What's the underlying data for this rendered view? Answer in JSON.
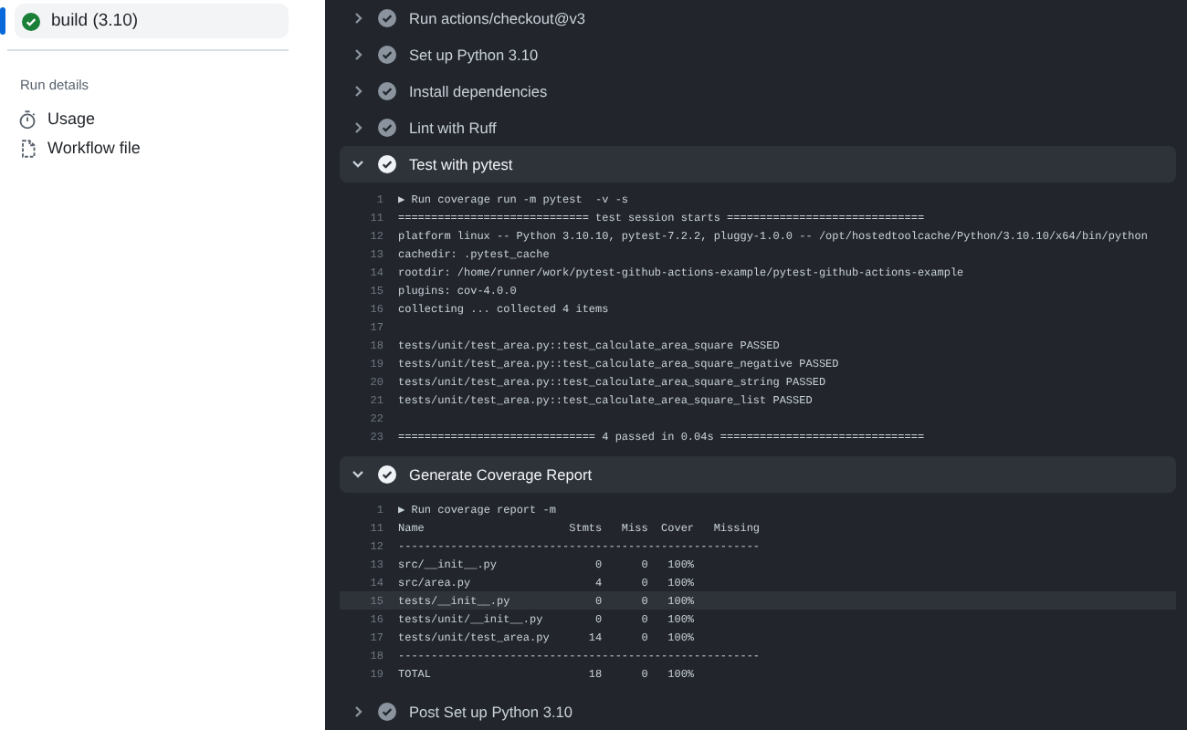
{
  "sidebar": {
    "jobs": [
      {
        "label": "build (3.10)",
        "selected": true
      }
    ],
    "section_title": "Run details",
    "items": [
      {
        "label": "Usage",
        "kind": "usage"
      },
      {
        "label": "Workflow file",
        "kind": "workflow"
      }
    ]
  },
  "steps": [
    {
      "name": "Run actions/checkout@v3",
      "expanded": false
    },
    {
      "name": "Set up Python 3.10",
      "expanded": false
    },
    {
      "name": "Install dependencies",
      "expanded": false
    },
    {
      "name": "Lint with Ruff",
      "expanded": false
    },
    {
      "name": "Test with pytest",
      "expanded": true,
      "log": [
        {
          "number": "1",
          "text": "▶ Run coverage run -m pytest  -v -s",
          "highlighted": false
        },
        {
          "number": "11",
          "text": "============================= test session starts ==============================",
          "highlighted": false
        },
        {
          "number": "12",
          "text": "platform linux -- Python 3.10.10, pytest-7.2.2, pluggy-1.0.0 -- /opt/hostedtoolcache/Python/3.10.10/x64/bin/python",
          "highlighted": false
        },
        {
          "number": "13",
          "text": "cachedir: .pytest_cache",
          "highlighted": false
        },
        {
          "number": "14",
          "text": "rootdir: /home/runner/work/pytest-github-actions-example/pytest-github-actions-example",
          "highlighted": false
        },
        {
          "number": "15",
          "text": "plugins: cov-4.0.0",
          "highlighted": false
        },
        {
          "number": "16",
          "text": "collecting ... collected 4 items",
          "highlighted": false
        },
        {
          "number": "17",
          "highlighted": false
        },
        {
          "number": "18",
          "text": "tests/unit/test_area.py::test_calculate_area_square PASSED",
          "highlighted": false
        },
        {
          "number": "19",
          "text": "tests/unit/test_area.py::test_calculate_area_square_negative PASSED",
          "highlighted": false
        },
        {
          "number": "20",
          "text": "tests/unit/test_area.py::test_calculate_area_square_string PASSED",
          "highlighted": false
        },
        {
          "number": "21",
          "text": "tests/unit/test_area.py::test_calculate_area_square_list PASSED",
          "highlighted": false
        },
        {
          "number": "22",
          "highlighted": false
        },
        {
          "number": "23",
          "text": "============================== 4 passed in 0.04s ===============================",
          "highlighted": false
        }
      ]
    },
    {
      "name": "Generate Coverage Report",
      "expanded": true,
      "log": [
        {
          "number": "1",
          "text": "▶ Run coverage report -m",
          "highlighted": false
        },
        {
          "number": "11",
          "text": "Name                      Stmts   Miss  Cover   Missing",
          "highlighted": false
        },
        {
          "number": "12",
          "text": "-------------------------------------------------------",
          "highlighted": false
        },
        {
          "number": "13",
          "text": "src/__init__.py               0      0   100%",
          "highlighted": false
        },
        {
          "number": "14",
          "text": "src/area.py                   4      0   100%",
          "highlighted": false
        },
        {
          "number": "15",
          "text": "tests/__init__.py             0      0   100%",
          "highlighted": true
        },
        {
          "number": "16",
          "text": "tests/unit/__init__.py        0      0   100%",
          "highlighted": false
        },
        {
          "number": "17",
          "text": "tests/unit/test_area.py      14      0   100%",
          "highlighted": false
        },
        {
          "number": "18",
          "text": "-------------------------------------------------------",
          "highlighted": false
        },
        {
          "number": "19",
          "text": "TOTAL                        18      0   100%",
          "highlighted": false
        }
      ]
    },
    {
      "name": "Post Set up Python 3.10",
      "expanded": false
    }
  ]
}
